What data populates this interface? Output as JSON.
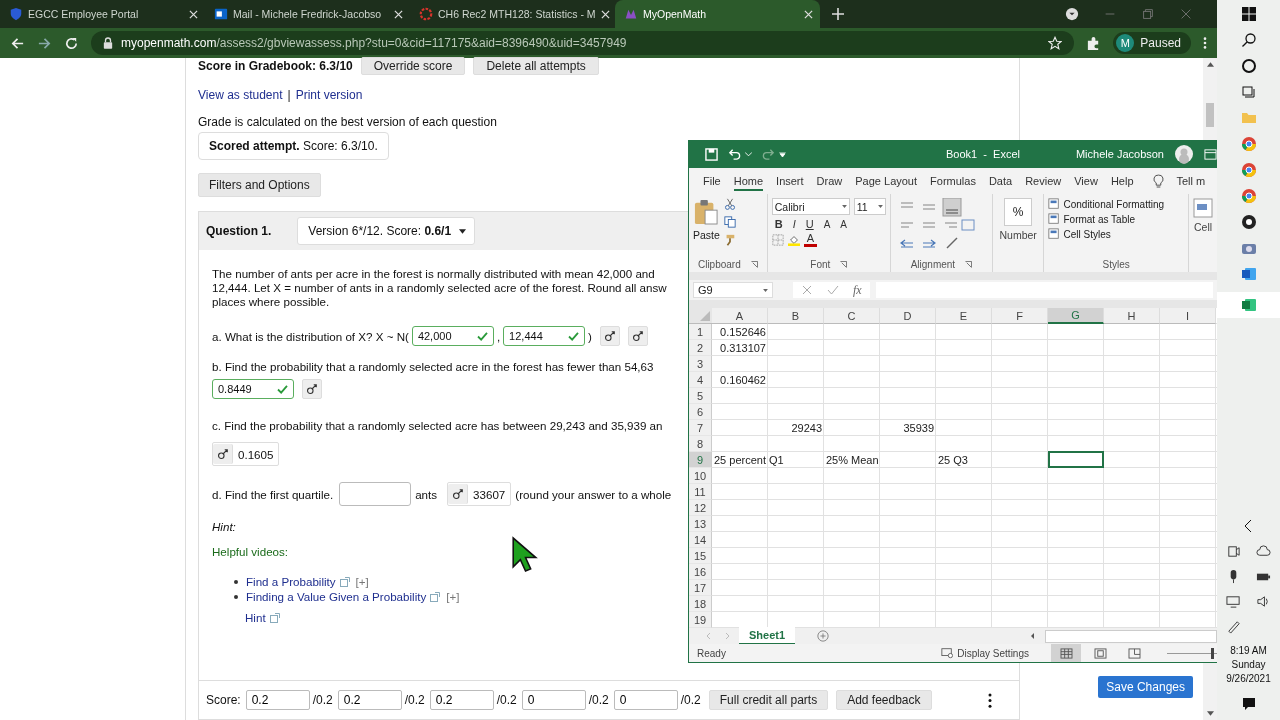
{
  "browser": {
    "tabs": [
      {
        "title": "EGCC Employee Portal",
        "selected": false,
        "kind": "shield"
      },
      {
        "title": "Mail - Michele Fredrick-Jacobso",
        "selected": false,
        "kind": "mail"
      },
      {
        "title": "CH6 Rec2 MTH128: Statistics - M",
        "selected": false,
        "kind": "ring"
      },
      {
        "title": "MyOpenMath",
        "selected": true,
        "kind": "app"
      }
    ],
    "url_host": "myopenmath.com",
    "url_path": "/assess2/gbviewassess.php?stu=0&cid=117175&aid=8396490&uid=3457949",
    "profile": {
      "initial": "M",
      "status": "Paused"
    }
  },
  "gradebook": {
    "score_label": "Score in Gradebook: 6.3/10",
    "buttons": [
      "Override score",
      "Delete all attempts"
    ],
    "links": [
      "View as student",
      "Print version"
    ],
    "separator": "|",
    "grade_note": "Grade is calculated on the best version of each question",
    "scored_attempt": "**Scored attempt.** Score: 6.3/10.",
    "filters_button": "Filters and Options"
  },
  "question": {
    "label": "Question 1.",
    "version": "Version 6*/12. Score: **0.6/1**",
    "text": "The number of ants per acre in the forest is normally distributed with mean 42,000 and\n12,444. Let X = number of ants in a randomly selected acre of the forest. Round all answ\nplaces where possible.",
    "part_a": {
      "prompt": "a. What is the distribution of X? X ~ N(",
      "answers": [
        {
          "value": "42,000",
          "correct": true
        },
        {
          "value": "12,444",
          "correct": true
        }
      ],
      "separator": ",",
      "close": ")"
    },
    "part_b": {
      "prompt": "b. Find the probability that a randomly selected acre in the forest has fewer than 54,63",
      "answer": {
        "value": "0.8449",
        "correct": true
      }
    },
    "part_c": {
      "prompt": "c. Find the probability that a randomly selected acre has between 29,243 and 35,939 an",
      "shown_answer": "0.1605"
    },
    "part_d": {
      "prompt": "d. Find the first quartile.",
      "unit": "ants",
      "shown_answer": "33607",
      "suffix": "(round your answer to a whole"
    },
    "hint_label": "Hint:",
    "videos_heading": "Helpful videos:",
    "videos": [
      {
        "title": "Find a Probability",
        "expand": "[+]"
      },
      {
        "title": "Finding a Value Given a Probability",
        "expand": "[+]"
      }
    ],
    "hint_link": "Hint"
  },
  "score_bar": {
    "label": "Score:",
    "parts": [
      {
        "value": "0.2",
        "max": "/0.2"
      },
      {
        "value": "0.2",
        "max": "/0.2"
      },
      {
        "value": "0.2",
        "max": "/0.2"
      },
      {
        "value": "0",
        "max": "/0.2"
      },
      {
        "value": "0",
        "max": "/0.2"
      }
    ],
    "buttons": [
      "Full credit all parts",
      "Add feedback"
    ]
  },
  "save_button": "Save Changes",
  "excel": {
    "title": "Book1  -  Excel",
    "user": "Michele Jacobson",
    "menu": [
      {
        "label": "File",
        "selected": false
      },
      {
        "label": "Home",
        "selected": true
      },
      {
        "label": "Insert",
        "selected": false
      },
      {
        "label": "Draw",
        "selected": false
      },
      {
        "label": "Page Layout",
        "selected": false
      },
      {
        "label": "Formulas",
        "selected": false
      },
      {
        "label": "Data",
        "selected": false
      },
      {
        "label": "Review",
        "selected": false
      },
      {
        "label": "View",
        "selected": false
      },
      {
        "label": "Help",
        "selected": false
      }
    ],
    "tell_me": "Tell m",
    "clipboard": {
      "paste": "Paste",
      "label": "Clipboard"
    },
    "font": {
      "name": "Calibri",
      "size": "11",
      "styles": [
        "B",
        "I",
        "U"
      ],
      "size_buttons": [
        "A",
        "A"
      ],
      "color_button": "A",
      "label": "Font"
    },
    "alignment": {
      "label": "Alignment"
    },
    "number": {
      "symbol": "%",
      "label": "Number"
    },
    "styles": {
      "items": [
        "Conditional Formatting",
        "Format as Table",
        "Cell Styles"
      ],
      "label": "Styles"
    },
    "cells": {
      "label": "Cell"
    },
    "name_box": "G9",
    "fx": "fx",
    "columns": [
      {
        "name": "A",
        "selected": false
      },
      {
        "name": "B",
        "selected": false
      },
      {
        "name": "C",
        "selected": false
      },
      {
        "name": "D",
        "selected": false
      },
      {
        "name": "E",
        "selected": false
      },
      {
        "name": "F",
        "selected": false
      },
      {
        "name": "G",
        "selected": true
      },
      {
        "name": "H",
        "selected": false
      },
      {
        "name": "I",
        "selected": false
      }
    ],
    "rows": [
      {
        "number": "1",
        "selected": false,
        "cells": [
          {
            "value": "0.152646",
            "kind": "number"
          }
        ]
      },
      {
        "number": "2",
        "selected": false,
        "cells": [
          {
            "value": "0.313107",
            "kind": "number"
          }
        ]
      },
      {
        "number": "3",
        "selected": false,
        "cells": []
      },
      {
        "number": "4",
        "selected": false,
        "cells": [
          {
            "value": "0.160462",
            "kind": "number"
          }
        ]
      },
      {
        "number": "5",
        "selected": false,
        "cells": []
      },
      {
        "number": "6",
        "selected": false,
        "cells": []
      },
      {
        "number": "7",
        "selected": false,
        "cells": [
          null,
          {
            "value": "29243",
            "kind": "number"
          },
          null,
          {
            "value": "35939",
            "kind": "number"
          }
        ]
      },
      {
        "number": "8",
        "selected": false,
        "cells": []
      },
      {
        "number": "9",
        "selected": true,
        "cells": [
          {
            "value": "25 percent Q1",
            "kind": "text"
          },
          null,
          {
            "value": "25% Mean",
            "kind": "text"
          },
          null,
          {
            "value": "25 Q3",
            "kind": "text"
          }
        ]
      },
      {
        "number": "10",
        "selected": false,
        "cells": []
      },
      {
        "number": "11",
        "selected": false,
        "cells": []
      },
      {
        "number": "12",
        "selected": false,
        "cells": []
      },
      {
        "number": "13",
        "selected": false,
        "cells": []
      },
      {
        "number": "14",
        "selected": false,
        "cells": []
      },
      {
        "number": "15",
        "selected": false,
        "cells": []
      },
      {
        "number": "16",
        "selected": false,
        "cells": []
      },
      {
        "number": "17",
        "selected": false,
        "cells": []
      },
      {
        "number": "18",
        "selected": false,
        "cells": []
      },
      {
        "number": "19",
        "selected": false,
        "cells": []
      }
    ],
    "sheets": [
      {
        "name": "Sheet1",
        "selected": true
      }
    ],
    "status": "Ready",
    "display_settings": "Display Settings",
    "views": [
      {
        "selected": true
      },
      {
        "selected": false
      },
      {
        "selected": false
      }
    ],
    "zoom": {
      "level": 0.93
    }
  },
  "clock": {
    "time": "8:19 AM",
    "day": "Sunday",
    "date": "9/26/2021"
  }
}
